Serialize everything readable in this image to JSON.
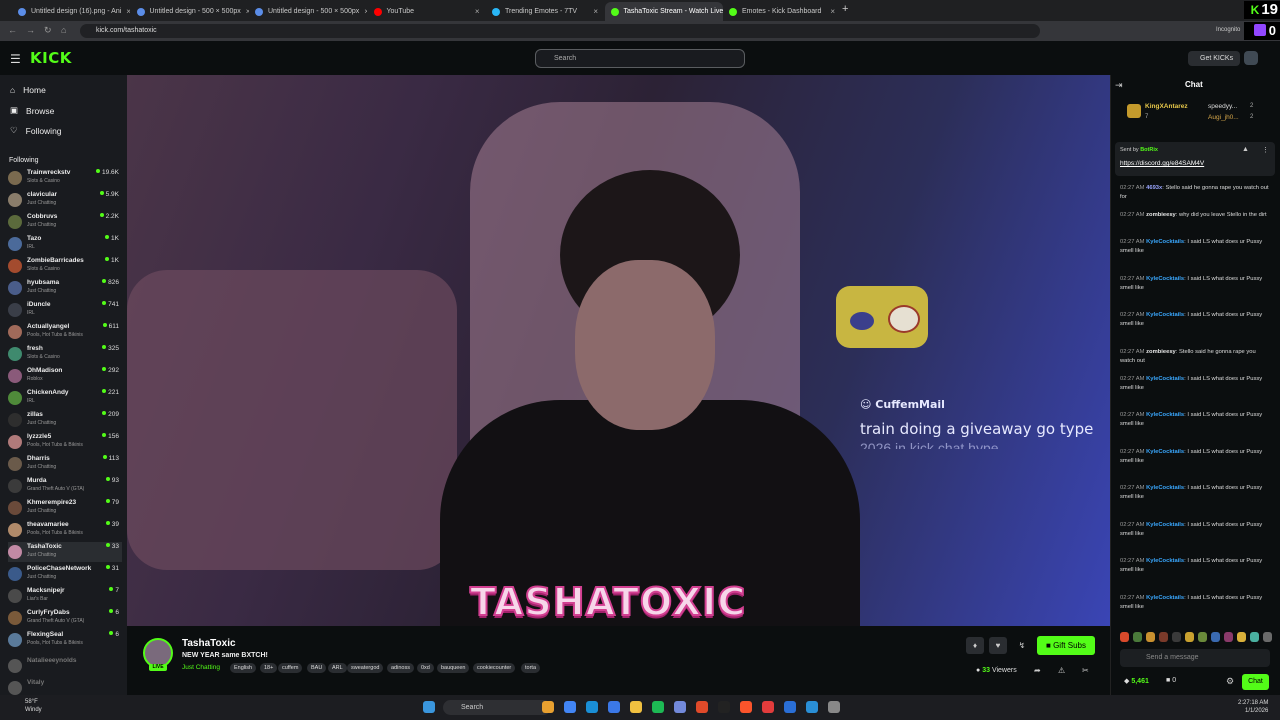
{
  "browser": {
    "tabs": [
      {
        "label": "Untitled design (16).png - Ani",
        "color": "#5b8de8"
      },
      {
        "label": "Untitled design - 500 × 500px",
        "color": "#5b8de8"
      },
      {
        "label": "Untitled design - 500 × 500px",
        "color": "#5b8de8"
      },
      {
        "label": "YouTube",
        "color": "#ff0000"
      },
      {
        "label": "Trending Emotes - 7TV",
        "color": "#29b6f6"
      },
      {
        "label": "TashaToxic Stream - Watch Live",
        "color": "#53fc18"
      },
      {
        "label": "Emotes - Kick Dashboard",
        "color": "#53fc18"
      }
    ],
    "url": "kick.com/tashatoxic",
    "profile_label": "Incognito"
  },
  "overlays": {
    "kick_count": "19",
    "twitch_count": "0"
  },
  "header": {
    "logo": "KICK",
    "search_placeholder": "Search",
    "get_kicks_label": "Get KICKs"
  },
  "nav": {
    "home": "Home",
    "browse": "Browse",
    "following": "Following",
    "following_title": "Following"
  },
  "following": [
    {
      "name": "Trainwreckstv",
      "category": "Slots & Casino",
      "viewers": "19.6K",
      "color": "#7a6a4f"
    },
    {
      "name": "clavicular",
      "category": "Just Chatting",
      "viewers": "5.9K",
      "color": "#8a7d6b"
    },
    {
      "name": "Cobbruvs",
      "category": "Just Chatting",
      "viewers": "2.2K",
      "color": "#5b6a3c"
    },
    {
      "name": "Tazo",
      "category": "IRL",
      "viewers": "1K",
      "color": "#4b6a9a"
    },
    {
      "name": "ZombieBarricades",
      "category": "Slots & Casino",
      "viewers": "1K",
      "color": "#a34b2e"
    },
    {
      "name": "hyubsama",
      "category": "Just Chatting",
      "viewers": "826",
      "color": "#4a5d8a"
    },
    {
      "name": "iDuncle",
      "category": "IRL",
      "viewers": "741",
      "color": "#3a3e48"
    },
    {
      "name": "Actuallyangel",
      "category": "Pools, Hot Tubs & Bikinis",
      "viewers": "611",
      "color": "#a06a5a"
    },
    {
      "name": "fresh",
      "category": "Slots & Casino",
      "viewers": "325",
      "color": "#3f8a6e"
    },
    {
      "name": "OhMadison",
      "category": "Roblox",
      "viewers": "292",
      "color": "#8a5a7a"
    },
    {
      "name": "ChickenAndy",
      "category": "IRL",
      "viewers": "221",
      "color": "#4f8a3a"
    },
    {
      "name": "zillas",
      "category": "Just Chatting",
      "viewers": "209",
      "color": "#2e2e2e"
    },
    {
      "name": "lyzzzle5",
      "category": "Pools, Hot Tubs & Bikinis",
      "viewers": "156",
      "color": "#b07a7a"
    },
    {
      "name": "Dharris",
      "category": "Just Chatting",
      "viewers": "113",
      "color": "#6a5a4a"
    },
    {
      "name": "Murda",
      "category": "Grand Theft Auto V (GTA)",
      "viewers": "93",
      "color": "#3b3b3b"
    },
    {
      "name": "Khmerempire23",
      "category": "Just Chatting",
      "viewers": "79",
      "color": "#6a4a3a"
    },
    {
      "name": "theavamariee",
      "category": "Pools, Hot Tubs & Bikinis",
      "viewers": "39",
      "color": "#b08a6a"
    },
    {
      "name": "TashaToxic",
      "category": "Just Chatting",
      "viewers": "33",
      "color": "#c28aa5"
    },
    {
      "name": "PoliceChaseNetwork",
      "category": "Just Chatting",
      "viewers": "31",
      "color": "#3a5a8a"
    },
    {
      "name": "Macksnipejr",
      "category": "Liar's Bar",
      "viewers": "7",
      "color": "#4a4a4a"
    },
    {
      "name": "CurlyFryDabs",
      "category": "Grand Theft Auto V (GTA)",
      "viewers": "6",
      "color": "#7a5a3a"
    },
    {
      "name": "FlexingSeal",
      "category": "Pools, Hot Tubs & Bikinis",
      "viewers": "6",
      "color": "#5a7a9a"
    }
  ],
  "offline": [
    {
      "name": "Natalieeeynolds",
      "color": "#555"
    },
    {
      "name": "Vitaly",
      "color": "#555"
    }
  ],
  "video": {
    "overlay_user": "CuffemMail",
    "overlay_message": "train doing a giveaway go type",
    "overlay_message_cut": "2026 in kick chat hype",
    "brand": "TASHATOXIC"
  },
  "stream": {
    "name": "TashaToxic",
    "title": "NEW YEAR same BXTCH!",
    "category": "Just Chatting",
    "tags": [
      "English",
      "18+",
      "cuffem",
      "BAU",
      "ARL",
      "sweatergod",
      "adinoss",
      "0xd",
      "bauqueen",
      "cookiecounter",
      "torta"
    ],
    "live_label": "LIVE",
    "gift_subs_label": "Gift Subs",
    "viewers_count": "33",
    "viewers_label": "Viewers"
  },
  "chat": {
    "title": "Chat",
    "leaderboard": [
      {
        "name": "KingXAntarez",
        "count": "7"
      },
      {
        "name": "speedyy...",
        "count": "2"
      },
      {
        "name": "Augi_jh0...",
        "count": "2"
      }
    ],
    "pinned": {
      "sent_by": "Sent by",
      "sender": "BotRix",
      "link": "https://discord.gg/e84SAM4V"
    },
    "messages": [
      {
        "time": "02:27 AM",
        "user": "4693x",
        "user_color": "#9aa5ff",
        "text": "Stello said he gonna rape you watch out for"
      },
      {
        "time": "02:27 AM",
        "user": "zombieesy",
        "user_color": "#e8e8e8",
        "text": "why did you leave Stello in the dirt"
      },
      {
        "time": "02:27 AM",
        "user": "KyleCocktails",
        "user_color": "#3aa8ff",
        "text": "I said LS what does ur Pussy smell like"
      },
      {
        "time": "02:27 AM",
        "user": "KyleCocktails",
        "user_color": "#3aa8ff",
        "text": "I said LS what does ur Pussy smell like"
      },
      {
        "time": "02:27 AM",
        "user": "KyleCocktails",
        "user_color": "#3aa8ff",
        "text": "I said LS what does ur Pussy smell like"
      },
      {
        "time": "02:27 AM",
        "user": "zombieesy",
        "user_color": "#e8e8e8",
        "text": "Stello said he gonna rape you watch out"
      },
      {
        "time": "02:27 AM",
        "user": "KyleCocktails",
        "user_color": "#3aa8ff",
        "text": "I said LS what does ur Pussy smell like"
      },
      {
        "time": "02:27 AM",
        "user": "KyleCocktails",
        "user_color": "#3aa8ff",
        "text": "I said LS what does ur Pussy smell like"
      },
      {
        "time": "02:27 AM",
        "user": "KyleCocktails",
        "user_color": "#3aa8ff",
        "text": "I said LS what does ur Pussy smell like"
      },
      {
        "time": "02:27 AM",
        "user": "KyleCocktails",
        "user_color": "#3aa8ff",
        "text": "I said LS what does ur Pussy smell like"
      },
      {
        "time": "02:27 AM",
        "user": "KyleCocktails",
        "user_color": "#3aa8ff",
        "text": "I said LS what does ur Pussy smell like"
      },
      {
        "time": "02:27 AM",
        "user": "KyleCocktails",
        "user_color": "#3aa8ff",
        "text": "I said LS what does ur Pussy smell like"
      },
      {
        "time": "02:27 AM",
        "user": "KyleCocktails",
        "user_color": "#3aa8ff",
        "text": "I said LS what does ur Pussy smell like"
      }
    ],
    "input_placeholder": "Send a message",
    "kicks_balance": "5,461",
    "gifts_count": "0",
    "chat_button": "Chat"
  },
  "taskbar": {
    "weather_temp": "58°F",
    "weather_desc": "Windy",
    "search_placeholder": "Search",
    "time": "2:27:18 AM",
    "date": "1/1/2026"
  },
  "colors": {
    "accent": "#53fc18",
    "background": "#0b0e0f",
    "sidebar": "#191b1f"
  }
}
